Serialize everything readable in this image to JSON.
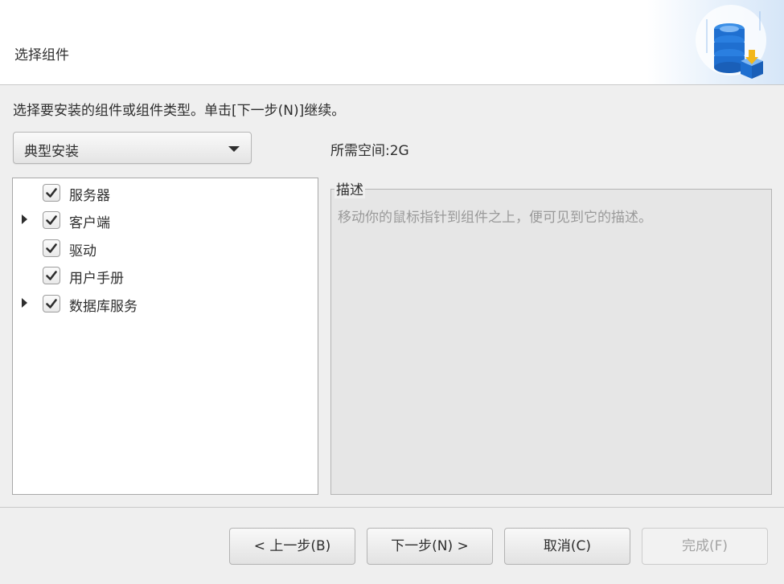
{
  "header": {
    "title": "选择组件",
    "icon": "database-install-icon"
  },
  "instruction": "选择要安装的组件或组件类型。单击[下一步(N)]继续。",
  "install_type": {
    "selected": "典型安装"
  },
  "required_space": "所需空间:2G",
  "components": [
    {
      "label": "服务器",
      "checked": true,
      "expandable": false
    },
    {
      "label": "客户端",
      "checked": true,
      "expandable": true
    },
    {
      "label": "驱动",
      "checked": true,
      "expandable": false
    },
    {
      "label": "用户手册",
      "checked": true,
      "expandable": false
    },
    {
      "label": "数据库服务",
      "checked": true,
      "expandable": true
    }
  ],
  "description": {
    "legend": "描述",
    "text": "移动你的鼠标指针到组件之上，便可见到它的描述。"
  },
  "buttons": {
    "back": "< 上一步(B)",
    "next": "下一步(N) >",
    "cancel": "取消(C)",
    "finish": "完成(F)"
  },
  "colors": {
    "accent_blue": "#1f6fd0",
    "accent_yellow": "#f2b71b"
  }
}
